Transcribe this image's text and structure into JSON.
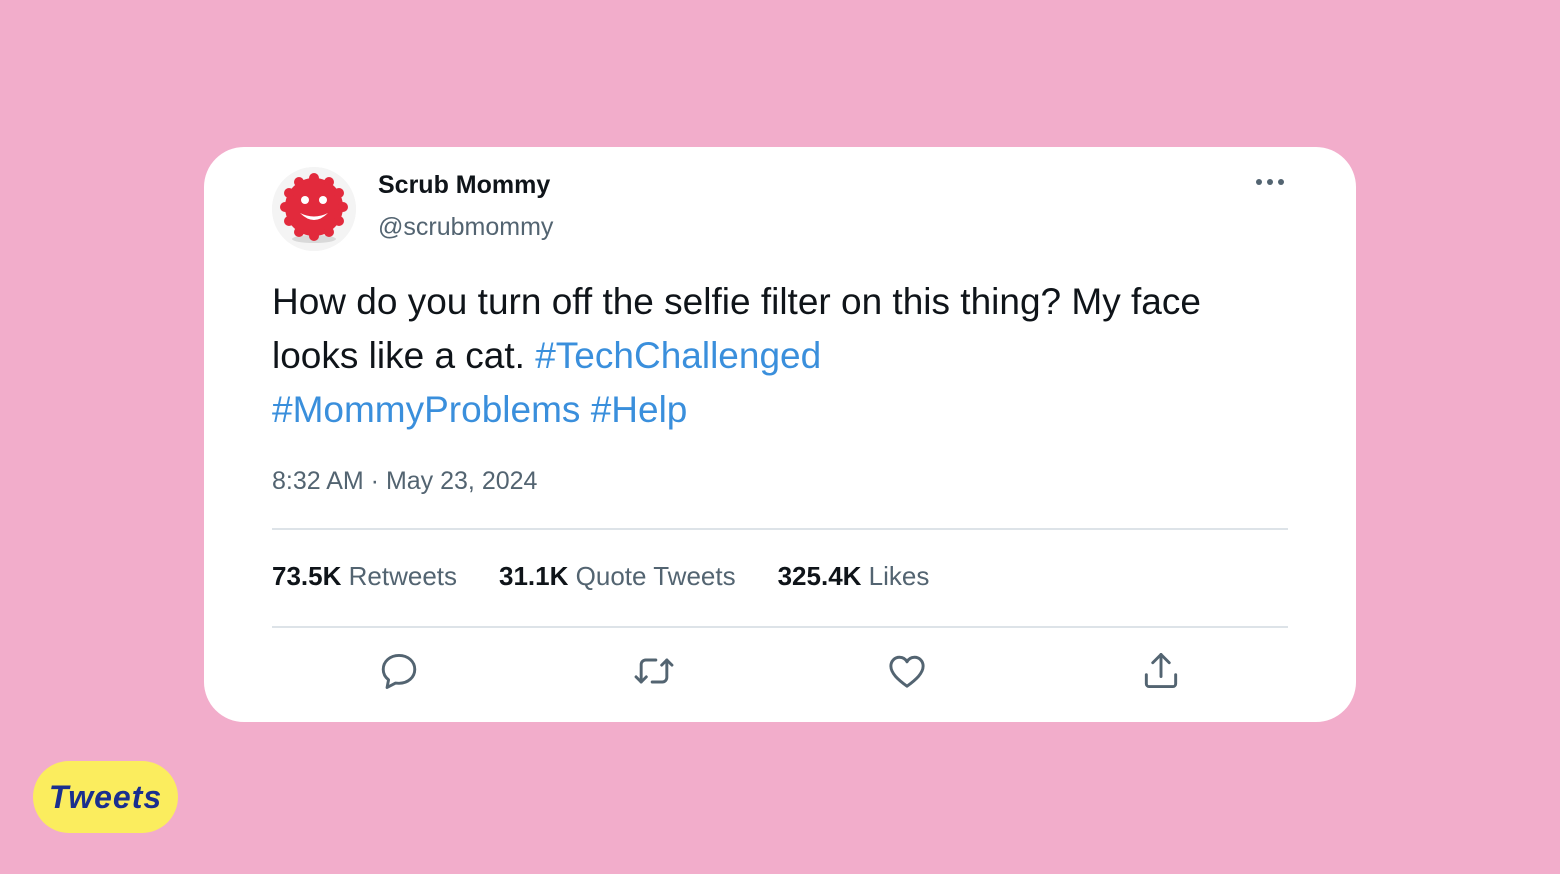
{
  "colors": {
    "background": "#f2adcb",
    "card": "#ffffff",
    "hashtag": "#3a8fdc",
    "pill": "#fbed5e",
    "pill_text": "#1a2f8f"
  },
  "tweet": {
    "author_name": "Scrub Mommy",
    "author_handle": "@scrubmommy",
    "text_plain": "How do you turn off the selfie filter on this thing? My face looks like a cat.",
    "hashtags": [
      "#TechChallenged",
      "#MommyProblems",
      "#Help"
    ],
    "timestamp": "8:32 AM · May 23, 2024",
    "stats": [
      {
        "count": "73.5K",
        "label": "Retweets"
      },
      {
        "count": "31.1K",
        "label": "Quote Tweets"
      },
      {
        "count": "325.4K",
        "label": "Likes"
      }
    ]
  },
  "icons": {
    "avatar": "smiley-sponge-avatar",
    "more": "more-options-icon",
    "reply": "reply-icon",
    "retweet": "retweet-icon",
    "like": "heart-icon",
    "share": "share-icon"
  },
  "badge": {
    "label": "Tweets"
  }
}
